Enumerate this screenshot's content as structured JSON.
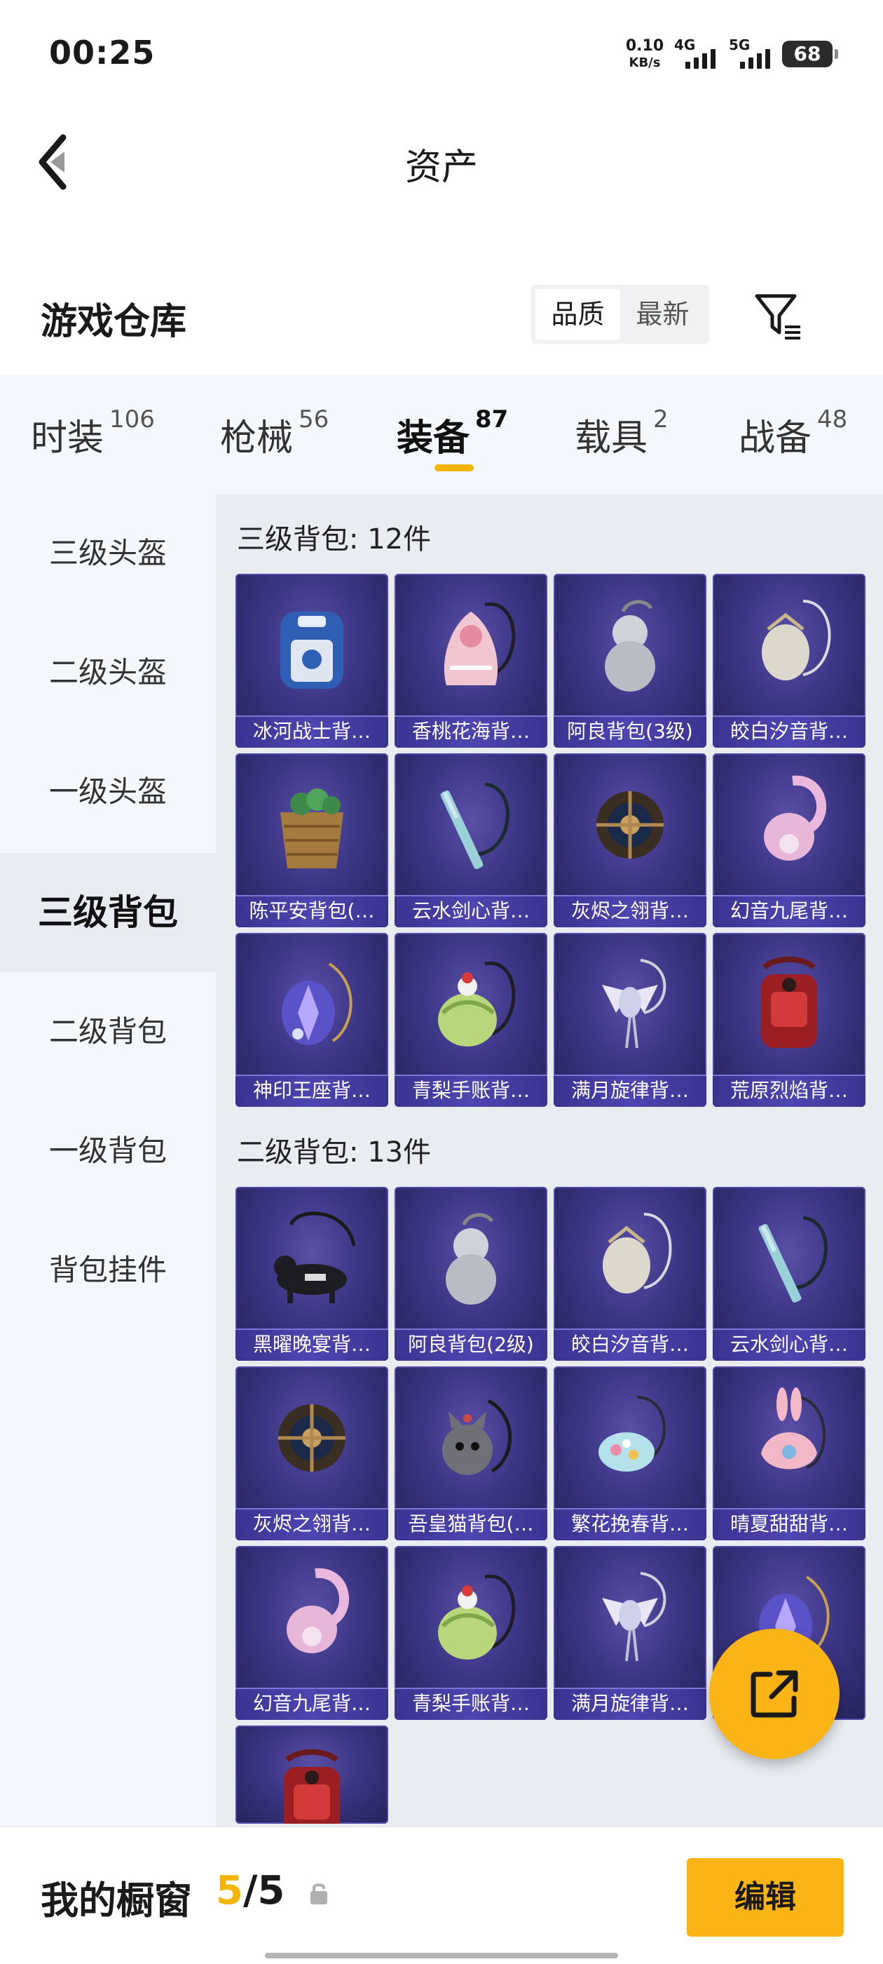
{
  "status_bar": {
    "time": "00:25",
    "net_speed_value": "0.10",
    "net_speed_unit": "KB/s",
    "signal_1": "4G",
    "signal_2": "5G",
    "battery": "68"
  },
  "header": {
    "title": "资产",
    "back_icon": "chevron-left-icon"
  },
  "warehouse": {
    "title": "游戏仓库",
    "sort_options": [
      "品质",
      "最新"
    ],
    "sort_selected": "品质",
    "filter_icon": "filter-icon"
  },
  "tabs": [
    {
      "label": "时装",
      "count": "106"
    },
    {
      "label": "枪械",
      "count": "56"
    },
    {
      "label": "装备",
      "count": "87"
    },
    {
      "label": "载具",
      "count": "2"
    },
    {
      "label": "战备",
      "count": "48"
    }
  ],
  "active_tab": "装备",
  "sidebar": [
    {
      "label": "三级头盔"
    },
    {
      "label": "二级头盔"
    },
    {
      "label": "一级头盔"
    },
    {
      "label": "三级背包"
    },
    {
      "label": "二级背包"
    },
    {
      "label": "一级背包"
    },
    {
      "label": "背包挂件"
    }
  ],
  "active_sidebar": "三级背包",
  "groups": [
    {
      "title": "三级背包: 12件",
      "items": [
        {
          "name": "冰河战士背…",
          "icon": "blue-backpack"
        },
        {
          "name": "香桃花海背…",
          "icon": "pink-dress-bag"
        },
        {
          "name": "阿良背包(3级)",
          "icon": "silver-gourd"
        },
        {
          "name": "皎白汐音背…",
          "icon": "white-shell-bag"
        },
        {
          "name": "陈平安背包(…",
          "icon": "wicker-basket"
        },
        {
          "name": "云水剑心背…",
          "icon": "sword-bag"
        },
        {
          "name": "灰烬之翎背…",
          "icon": "dark-shield-bag"
        },
        {
          "name": "幻音九尾背…",
          "icon": "pink-fox-bag"
        },
        {
          "name": "神印王座背…",
          "icon": "blue-crystal-bag"
        },
        {
          "name": "青梨手账背…",
          "icon": "green-cake-bag"
        },
        {
          "name": "满月旋律背…",
          "icon": "white-wing-bag"
        },
        {
          "name": "荒原烈焰背…",
          "icon": "red-backpack"
        }
      ]
    },
    {
      "title": "二级背包: 13件",
      "items": [
        {
          "name": "黑曜晚宴背…",
          "icon": "black-dog-bag"
        },
        {
          "name": "阿良背包(2级)",
          "icon": "silver-gourd"
        },
        {
          "name": "皎白汐音背…",
          "icon": "white-shell-bag"
        },
        {
          "name": "云水剑心背…",
          "icon": "sword-bag"
        },
        {
          "name": "灰烬之翎背…",
          "icon": "dark-shield-bag"
        },
        {
          "name": "吾皇猫背包(…",
          "icon": "grey-cat-bag"
        },
        {
          "name": "繁花挽春背…",
          "icon": "flower-bag"
        },
        {
          "name": "晴夏甜甜背…",
          "icon": "pink-bunny-bag"
        },
        {
          "name": "幻音九尾背…",
          "icon": "pink-fox-bag"
        },
        {
          "name": "青梨手账背…",
          "icon": "green-cake-bag"
        },
        {
          "name": "满月旋律背…",
          "icon": "white-wing-bag"
        },
        {
          "name": "",
          "icon": "blue-crystal-bag"
        },
        {
          "name": "",
          "icon": "red-backpack"
        }
      ]
    }
  ],
  "fab_icon": "share-external-icon",
  "bottom_bar": {
    "label": "我的橱窗",
    "count_current": "5",
    "count_separator": "/",
    "count_total": "5",
    "edit_label": "编辑"
  },
  "colors": {
    "accent": "#fbb416",
    "card_bg": "#3b3585"
  }
}
